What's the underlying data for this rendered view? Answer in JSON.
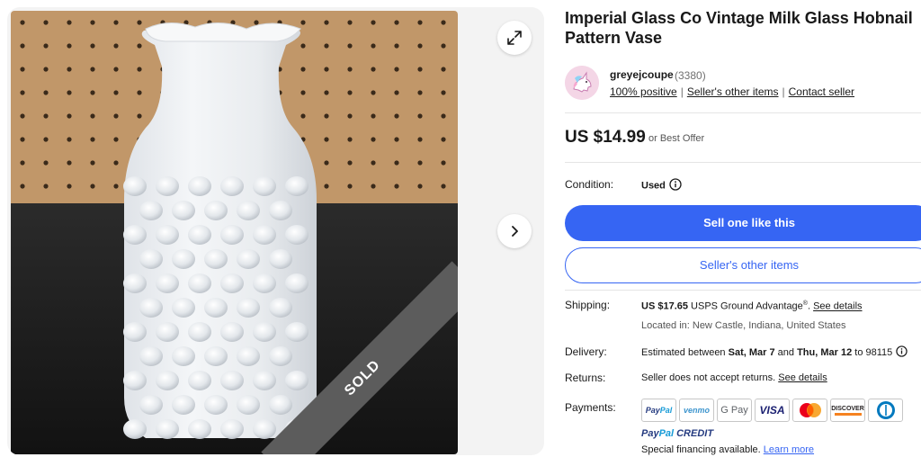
{
  "gallery": {
    "ribbon_text": "SOLD",
    "expand_icon": "expand-icon",
    "next_icon": "chevron-right-icon"
  },
  "listing": {
    "title": "Imperial Glass Co Vintage Milk Glass Hobnail Pattern Vase",
    "price": "US $14.99",
    "best_offer": "or Best Offer"
  },
  "seller": {
    "name": "greyejcoupe",
    "feedback_count": "(3380)",
    "positive": "100% positive",
    "other_items": "Seller's other items",
    "contact": "Contact seller"
  },
  "condition": {
    "label": "Condition:",
    "value": "Used"
  },
  "buttons": {
    "sell_one": "Sell one like this",
    "sellers_other_items": "Seller's other items"
  },
  "shipping": {
    "label": "Shipping:",
    "cost": "US $17.65",
    "service": "USPS Ground Advantage",
    "service_mark": "®",
    "see_details": "See details",
    "located_in": "Located in: New Castle, Indiana, United States"
  },
  "delivery": {
    "label": "Delivery:",
    "prefix": "Estimated between",
    "start_date": "Sat, Mar 7",
    "and_word": "and",
    "end_date": "Thu, Mar 12",
    "to_text": "to 98115"
  },
  "returns": {
    "label": "Returns:",
    "text": "Seller does not accept returns.",
    "see_details": "See details"
  },
  "payments": {
    "label": "Payments:",
    "methods": {
      "paypal_a": "Pay",
      "paypal_b": "Pal",
      "venmo": "venmo",
      "gpay": "G Pay",
      "visa": "VISA",
      "discover": "DISCOVER"
    },
    "paypal_credit_a": "Pay",
    "paypal_credit_b": "Pal",
    "paypal_credit_c": "CREDIT",
    "financing": "Special financing available.",
    "learn_more": "Learn more"
  },
  "colors": {
    "primary_blue": "#3665f3",
    "sold_ribbon": "#5c5c5c",
    "text": "#191919"
  }
}
